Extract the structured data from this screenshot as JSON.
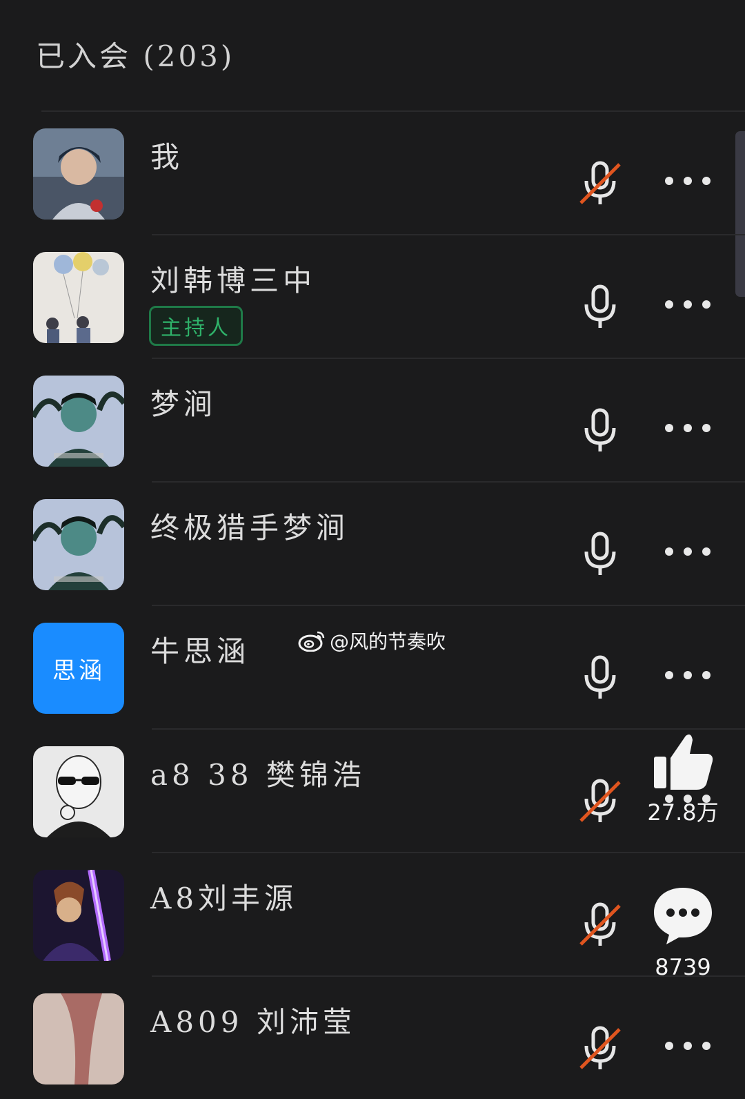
{
  "header": {
    "title": "已入会 (203)"
  },
  "participants": [
    {
      "name": "我",
      "muted": true
    },
    {
      "name": "刘韩博三中",
      "role": "主持人",
      "muted": false
    },
    {
      "name": "梦涧",
      "muted": false
    },
    {
      "name": "终极猎手梦涧",
      "muted": false
    },
    {
      "name": "牛思涵",
      "avatar_text": "思涵",
      "muted": false
    },
    {
      "name": "a8 38 樊锦浩",
      "muted": true
    },
    {
      "name": "A8刘丰源",
      "muted": true
    },
    {
      "name": "A809 刘沛莹",
      "muted": true
    }
  ],
  "watermark": {
    "text": "@风的节奏吹",
    "icon": "weibo-icon"
  },
  "overlay": {
    "like_count": "27.8万",
    "comment_count": "8739"
  },
  "colors": {
    "background": "#1b1b1c",
    "host_badge": "#2fb36a",
    "mute_slash": "#e0551f",
    "avatar_blue": "#1a8cff"
  }
}
